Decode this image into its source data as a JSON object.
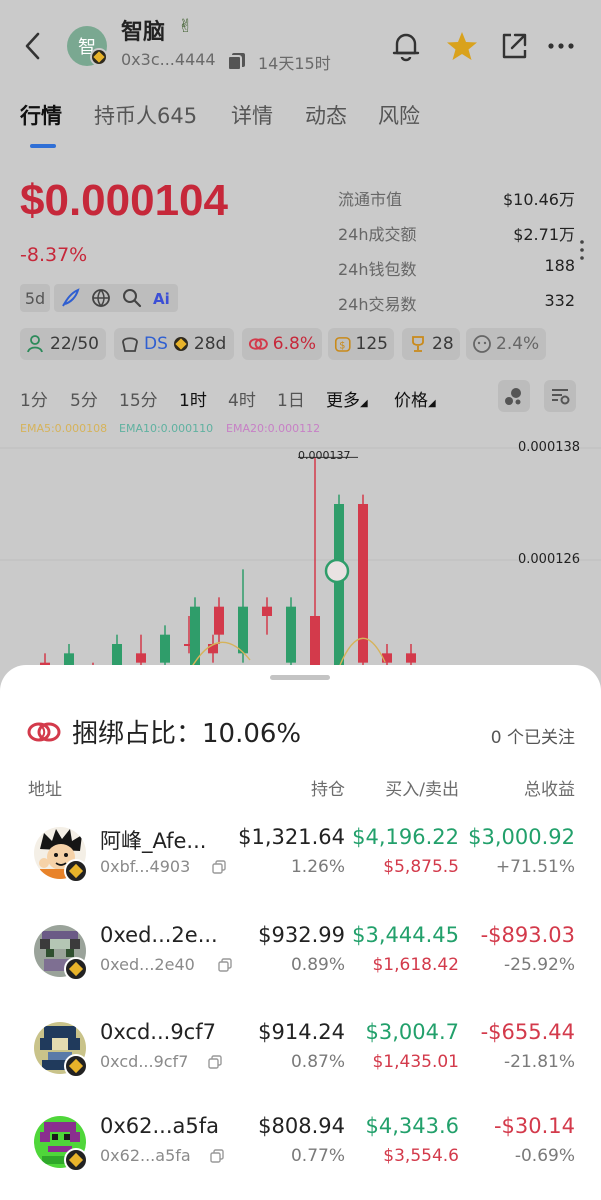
{
  "token": {
    "name": "智脑",
    "avatar_char": "智",
    "emoji": "✌",
    "address_short": "0x3c...4444",
    "age": "14天15时",
    "icons": {
      "back": "back-arrow-icon",
      "bell": "bell-icon",
      "star": "star-icon",
      "share": "share-icon",
      "more": "more-icon"
    }
  },
  "tabs": [
    {
      "label": "行情",
      "active": true
    },
    {
      "label": "持币人645",
      "active": false
    },
    {
      "label": "详情",
      "active": false
    },
    {
      "label": "动态",
      "active": false
    },
    {
      "label": "风险",
      "active": false
    }
  ],
  "market": {
    "price": "$0.000104",
    "change": "-8.37%",
    "stats": [
      {
        "label": "流通市值",
        "value": "$10.46万"
      },
      {
        "label": "24h成交额",
        "value": "$2.71万"
      },
      {
        "label": "24h钱包数",
        "value": "188"
      },
      {
        "label": "24h交易数",
        "value": "332"
      }
    ],
    "period_button": "5d"
  },
  "chips": [
    {
      "icon": "holders-icon",
      "text": "22/50"
    },
    {
      "icon": "ds-icon",
      "text": "DS"
    },
    {
      "icon": "bnb-icon",
      "text": "28d"
    },
    {
      "icon": "bundle-icon",
      "text": "6.8%"
    },
    {
      "icon": "dollar-bag-icon",
      "text": "125"
    },
    {
      "icon": "trophy-icon",
      "text": "28"
    },
    {
      "icon": "face-icon",
      "text": "2.4%"
    }
  ],
  "timeframes": [
    {
      "label": "1分",
      "selected": false
    },
    {
      "label": "5分",
      "selected": false
    },
    {
      "label": "15分",
      "selected": false
    },
    {
      "label": "1时",
      "selected": true
    },
    {
      "label": "4时",
      "selected": false
    },
    {
      "label": "1日",
      "selected": false
    }
  ],
  "more_label": "更多",
  "price_label": "价格",
  "ema": [
    {
      "text": "EMA5:0.000108",
      "color": "#d6b35a"
    },
    {
      "text": "EMA10:0.000110",
      "color": "#5fb1a0"
    },
    {
      "text": "EMA20:0.000112",
      "color": "#c780c6"
    }
  ],
  "chart_data": {
    "type": "candlestick",
    "y_ticks": [
      "0.000138",
      "0.000126"
    ],
    "peak_label": "0.000137",
    "candles": [
      {
        "o": 0.000114,
        "c": 0.000115,
        "h": 0.000116,
        "l": 0.000113,
        "up": false
      },
      {
        "o": 0.000113,
        "c": 0.000116,
        "h": 0.000117,
        "l": 0.000112,
        "up": true
      },
      {
        "o": 0.000114,
        "c": 0.000113,
        "h": 0.000115,
        "l": 0.000112,
        "up": false
      },
      {
        "o": 0.000114,
        "c": 0.000117,
        "h": 0.000118,
        "l": 0.000113,
        "up": true
      },
      {
        "o": 0.000116,
        "c": 0.000115,
        "h": 0.000118,
        "l": 0.000114,
        "up": false
      },
      {
        "o": 0.000115,
        "c": 0.000118,
        "h": 0.000119,
        "l": 0.000114,
        "up": true
      },
      {
        "o": 0.000117,
        "c": 0.000117,
        "h": 0.00012,
        "l": 0.000116,
        "up": false
      },
      {
        "o": 0.000117,
        "c": 0.000116,
        "h": 0.000118,
        "l": 0.000115,
        "up": false
      },
      {
        "o": 0.000114,
        "c": 0.000121,
        "h": 0.000122,
        "l": 0.000113,
        "up": true
      },
      {
        "o": 0.000121,
        "c": 0.000118,
        "h": 0.000122,
        "l": 0.000117,
        "up": false
      },
      {
        "o": 0.000116,
        "c": 0.000121,
        "h": 0.000125,
        "l": 0.000115,
        "up": true
      },
      {
        "o": 0.000121,
        "c": 0.00012,
        "h": 0.000122,
        "l": 0.000118,
        "up": false
      },
      {
        "o": 0.000115,
        "c": 0.000121,
        "h": 0.000122,
        "l": 0.000114,
        "up": true
      },
      {
        "o": 0.00012,
        "c": 0.000113,
        "h": 0.000137,
        "l": 0.000112,
        "up": false
      },
      {
        "o": 0.000113,
        "c": 0.000132,
        "h": 0.000133,
        "l": 0.000112,
        "up": true
      },
      {
        "o": 0.000132,
        "c": 0.000115,
        "h": 0.000133,
        "l": 0.000114,
        "up": false
      },
      {
        "o": 0.000116,
        "c": 0.000115,
        "h": 0.000117,
        "l": 0.000114,
        "up": false
      },
      {
        "o": 0.000116,
        "c": 0.000115,
        "h": 0.000117,
        "l": 0.000114,
        "up": false
      }
    ]
  },
  "sheet": {
    "title": "捆绑占比：10.06%",
    "follow_text": "0 个已关注",
    "headers": {
      "address": "地址",
      "holding": "持仓",
      "buy_sell": "买入/卖出",
      "total_pnl": "总收益"
    },
    "rows": [
      {
        "name": "阿峰_Afe...",
        "address": "0xbf...4903",
        "holding": "$1,321.64",
        "holding_pct": "1.26%",
        "buy": "$4,196.22",
        "sell": "$5,875.5",
        "pnl": "$3,000.92",
        "pnl_pct": "+71.51%",
        "pnl_positive": true,
        "avatar": "cartoon"
      },
      {
        "name": "0xed...2e...",
        "address": "0xed...2e40",
        "holding": "$932.99",
        "holding_pct": "0.89%",
        "buy": "$3,444.45",
        "sell": "$1,618.42",
        "pnl": "-$893.03",
        "pnl_pct": "-25.92%",
        "pnl_positive": false,
        "avatar": "pixel-gray"
      },
      {
        "name": "0xcd...9cf7",
        "address": "0xcd...9cf7",
        "holding": "$914.24",
        "holding_pct": "0.87%",
        "buy": "$3,004.7",
        "sell": "$1,435.01",
        "pnl": "-$655.44",
        "pnl_pct": "-21.81%",
        "pnl_positive": false,
        "avatar": "pixel-navy"
      },
      {
        "name": "0x62...a5fa",
        "address": "0x62...a5fa",
        "holding": "$808.94",
        "holding_pct": "0.77%",
        "buy": "$4,343.6",
        "sell": "$3,554.6",
        "pnl": "-$30.14",
        "pnl_pct": "-0.69%",
        "pnl_positive": false,
        "avatar": "pixel-green"
      }
    ]
  }
}
